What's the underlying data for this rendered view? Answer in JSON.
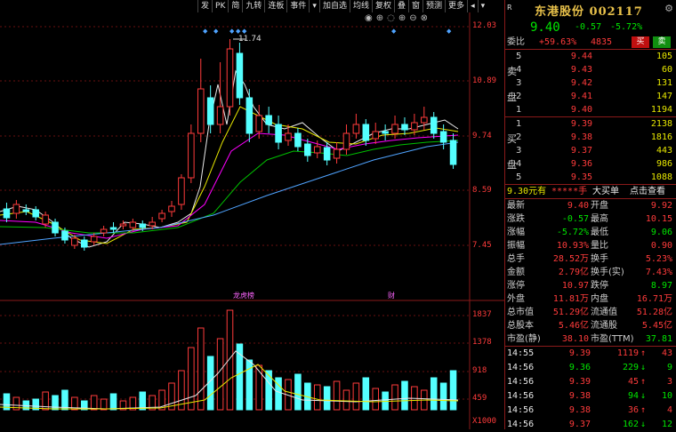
{
  "toolbar": [
    "发",
    "PK",
    "简",
    "九转",
    "连板",
    "事件",
    "▾",
    "加自选",
    "均线",
    "复权",
    "叠",
    "窗",
    "预测",
    "更多",
    "◂",
    "▾"
  ],
  "price_axis": [
    "12.03",
    "10.89",
    "9.74",
    "8.59",
    "7.45"
  ],
  "vol_axis": [
    "1837",
    "1378",
    "918",
    "459",
    "X1000"
  ],
  "peak_label": "11.74",
  "event_tags": [
    "龙虎榜",
    "财"
  ],
  "stock": {
    "name": "东港股份",
    "code": "002117",
    "price": "9.40",
    "change": "-0.57",
    "pct": "-5.72%"
  },
  "header_tag": "R",
  "weibi": {
    "label": "委比",
    "pct": "+59.63%",
    "diff": "4835",
    "sell_btn": "买",
    "buy_btn": "卖"
  },
  "asks": [
    {
      "n": "5",
      "p": "9.44",
      "v": "105"
    },
    {
      "n": "4",
      "p": "9.43",
      "v": "60"
    },
    {
      "n": "3",
      "p": "9.42",
      "v": "131"
    },
    {
      "n": "2",
      "p": "9.41",
      "v": "147"
    },
    {
      "n": "1",
      "p": "9.40",
      "v": "1194"
    }
  ],
  "ask_labels": [
    "卖",
    "盘"
  ],
  "bids": [
    {
      "n": "1",
      "p": "9.39",
      "v": "2138"
    },
    {
      "n": "2",
      "p": "9.38",
      "v": "1816"
    },
    {
      "n": "3",
      "p": "9.37",
      "v": "443"
    },
    {
      "n": "4",
      "p": "9.36",
      "v": "986"
    },
    {
      "n": "5",
      "p": "9.35",
      "v": "1088"
    }
  ],
  "bid_labels": [
    "买",
    "盘"
  ],
  "big_order": {
    "price": "9.30元有",
    "mask": "*****手",
    "label": "大买单",
    "link": "点击查看"
  },
  "stats": [
    [
      "最新",
      "9.40",
      "开盘",
      "9.92"
    ],
    [
      "涨跌",
      "-0.57",
      "最高",
      "10.15"
    ],
    [
      "涨幅",
      "-5.72%",
      "最低",
      "9.06"
    ],
    [
      "振幅",
      "10.93%",
      "量比",
      "0.90"
    ],
    [
      "总手",
      "28.52万",
      "换手",
      "5.23%"
    ],
    [
      "金额",
      "2.79亿",
      "换手(实)",
      "7.43%"
    ],
    [
      "涨停",
      "10.97",
      "跌停",
      "8.97"
    ],
    [
      "外盘",
      "11.81万",
      "内盘",
      "16.71万"
    ],
    [
      "总市值",
      "51.29亿",
      "流通值",
      "51.28亿"
    ],
    [
      "总股本",
      "5.46亿",
      "流通股",
      "5.45亿"
    ],
    [
      "市盈(静)",
      "38.10",
      "市盈(TTM)",
      "37.81"
    ]
  ],
  "ticks": [
    {
      "t": "14:55",
      "p": "9.39",
      "v": "1119",
      "d": "up",
      "n": "43"
    },
    {
      "t": "14:56",
      "p": "9.36",
      "v": "229",
      "d": "down",
      "n": "9"
    },
    {
      "t": "14:56",
      "p": "9.39",
      "v": "45",
      "d": "up",
      "n": "3"
    },
    {
      "t": "14:56",
      "p": "9.38",
      "v": "94",
      "d": "down",
      "n": "10"
    },
    {
      "t": "14:56",
      "p": "9.38",
      "v": "36",
      "d": "up",
      "n": "4"
    },
    {
      "t": "14:56",
      "p": "9.37",
      "v": "162",
      "d": "down",
      "n": "12"
    }
  ]
}
